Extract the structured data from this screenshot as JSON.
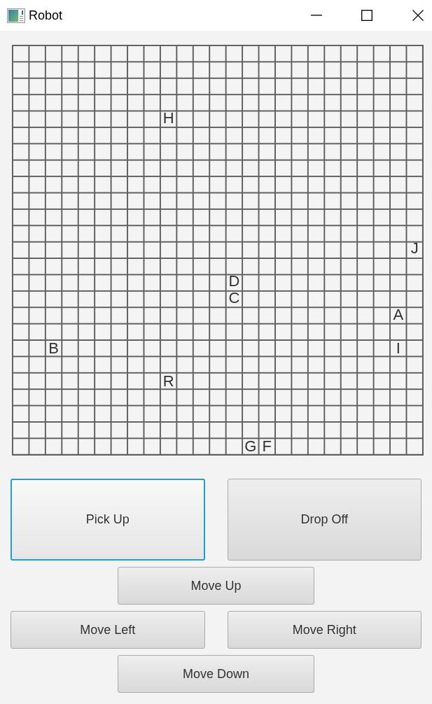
{
  "window": {
    "title": "Robot"
  },
  "grid": {
    "rows": [
      [
        null,
        null,
        null,
        null,
        null,
        null,
        null,
        null,
        null,
        null,
        null,
        null,
        null,
        null,
        null,
        null,
        null,
        null,
        null,
        null,
        null,
        null,
        null,
        null,
        null
      ],
      [
        null,
        null,
        null,
        null,
        null,
        null,
        null,
        null,
        null,
        null,
        null,
        null,
        null,
        null,
        null,
        null,
        null,
        null,
        null,
        null,
        null,
        null,
        null,
        null,
        null
      ],
      [
        null,
        null,
        null,
        null,
        null,
        null,
        null,
        null,
        null,
        null,
        null,
        null,
        null,
        null,
        null,
        null,
        null,
        null,
        null,
        null,
        null,
        null,
        null,
        null,
        null
      ],
      [
        null,
        null,
        null,
        null,
        null,
        null,
        null,
        null,
        null,
        null,
        null,
        null,
        null,
        null,
        null,
        null,
        null,
        null,
        null,
        null,
        null,
        null,
        null,
        null,
        null
      ],
      [
        null,
        null,
        null,
        null,
        null,
        null,
        null,
        null,
        null,
        "H",
        null,
        null,
        null,
        null,
        null,
        null,
        null,
        null,
        null,
        null,
        null,
        null,
        null,
        null,
        null
      ],
      [
        null,
        null,
        null,
        null,
        null,
        null,
        null,
        null,
        null,
        null,
        null,
        null,
        null,
        null,
        null,
        null,
        null,
        null,
        null,
        null,
        null,
        null,
        null,
        null,
        null
      ],
      [
        null,
        null,
        null,
        null,
        null,
        null,
        null,
        null,
        null,
        null,
        null,
        null,
        null,
        null,
        null,
        null,
        null,
        null,
        null,
        null,
        null,
        null,
        null,
        null,
        null
      ],
      [
        null,
        null,
        null,
        null,
        null,
        null,
        null,
        null,
        null,
        null,
        null,
        null,
        null,
        null,
        null,
        null,
        null,
        null,
        null,
        null,
        null,
        null,
        null,
        null,
        null
      ],
      [
        null,
        null,
        null,
        null,
        null,
        null,
        null,
        null,
        null,
        null,
        null,
        null,
        null,
        null,
        null,
        null,
        null,
        null,
        null,
        null,
        null,
        null,
        null,
        null,
        null
      ],
      [
        null,
        null,
        null,
        null,
        null,
        null,
        null,
        null,
        null,
        null,
        null,
        null,
        null,
        null,
        null,
        null,
        null,
        null,
        null,
        null,
        null,
        null,
        null,
        null,
        null
      ],
      [
        null,
        null,
        null,
        null,
        null,
        null,
        null,
        null,
        null,
        null,
        null,
        null,
        null,
        null,
        null,
        null,
        null,
        null,
        null,
        null,
        null,
        null,
        null,
        null,
        null
      ],
      [
        null,
        null,
        null,
        null,
        null,
        null,
        null,
        null,
        null,
        null,
        null,
        null,
        null,
        null,
        null,
        null,
        null,
        null,
        null,
        null,
        null,
        null,
        null,
        null,
        null
      ],
      [
        null,
        null,
        null,
        null,
        null,
        null,
        null,
        null,
        null,
        null,
        null,
        null,
        null,
        null,
        null,
        null,
        null,
        null,
        null,
        null,
        null,
        null,
        null,
        null,
        "J"
      ],
      [
        null,
        null,
        null,
        null,
        null,
        null,
        null,
        null,
        null,
        null,
        null,
        null,
        null,
        null,
        null,
        null,
        null,
        null,
        null,
        null,
        null,
        null,
        null,
        null,
        null
      ],
      [
        null,
        null,
        null,
        null,
        null,
        null,
        null,
        null,
        null,
        null,
        null,
        null,
        null,
        "D",
        null,
        null,
        null,
        null,
        null,
        null,
        null,
        null,
        null,
        null,
        null
      ],
      [
        null,
        null,
        null,
        null,
        null,
        null,
        null,
        null,
        null,
        null,
        null,
        null,
        null,
        "C",
        null,
        null,
        null,
        null,
        null,
        null,
        null,
        null,
        null,
        null,
        null
      ],
      [
        null,
        null,
        null,
        null,
        null,
        null,
        null,
        null,
        null,
        null,
        null,
        null,
        null,
        null,
        null,
        null,
        null,
        null,
        null,
        null,
        null,
        null,
        null,
        "A",
        null
      ],
      [
        null,
        null,
        null,
        null,
        null,
        null,
        null,
        null,
        null,
        null,
        null,
        null,
        null,
        null,
        null,
        null,
        null,
        null,
        null,
        null,
        null,
        null,
        null,
        null,
        null
      ],
      [
        null,
        null,
        "B",
        null,
        null,
        null,
        null,
        null,
        null,
        null,
        null,
        null,
        null,
        null,
        null,
        null,
        null,
        null,
        null,
        null,
        null,
        null,
        null,
        "I",
        null
      ],
      [
        null,
        null,
        null,
        null,
        null,
        null,
        null,
        null,
        null,
        null,
        null,
        null,
        null,
        null,
        null,
        null,
        null,
        null,
        null,
        null,
        null,
        null,
        null,
        null,
        null
      ],
      [
        null,
        null,
        null,
        null,
        null,
        null,
        null,
        null,
        null,
        "R",
        null,
        null,
        null,
        null,
        null,
        null,
        null,
        null,
        null,
        null,
        null,
        null,
        null,
        null,
        null
      ],
      [
        null,
        null,
        null,
        null,
        null,
        null,
        null,
        null,
        null,
        null,
        null,
        null,
        null,
        null,
        null,
        null,
        null,
        null,
        null,
        null,
        null,
        null,
        null,
        null,
        null
      ],
      [
        null,
        null,
        null,
        null,
        null,
        null,
        null,
        null,
        null,
        null,
        null,
        null,
        null,
        null,
        null,
        null,
        null,
        null,
        null,
        null,
        null,
        null,
        null,
        null,
        null
      ],
      [
        null,
        null,
        null,
        null,
        null,
        null,
        null,
        null,
        null,
        null,
        null,
        null,
        null,
        null,
        null,
        null,
        null,
        null,
        null,
        null,
        null,
        null,
        null,
        null,
        null
      ],
      [
        null,
        null,
        null,
        null,
        null,
        null,
        null,
        null,
        null,
        null,
        null,
        null,
        null,
        null,
        "G",
        "F",
        null,
        null,
        null,
        null,
        null,
        null,
        null,
        null,
        null
      ]
    ]
  },
  "button_rows": [
    [
      {
        "label": "Pick Up",
        "focused": true
      },
      {
        "label": "Drop Off",
        "focused": false
      }
    ],
    [
      {
        "label": "Move Up",
        "focused": false
      }
    ],
    [
      {
        "label": "Move Left",
        "focused": false
      },
      {
        "label": "Move Right",
        "focused": false
      }
    ],
    [
      {
        "label": "Move Down",
        "focused": false
      }
    ]
  ]
}
